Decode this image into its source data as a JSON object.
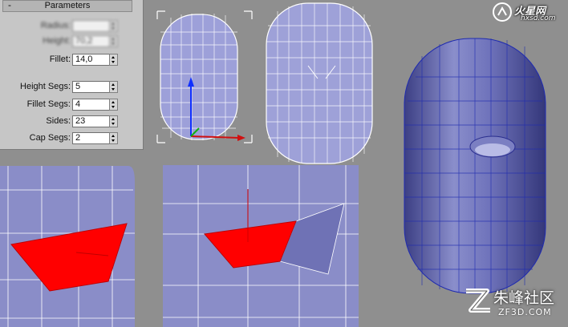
{
  "rollout": {
    "collapse_symbol": "-",
    "title": "Parameters",
    "fields": [
      {
        "label": "Radius:",
        "value": "",
        "obscured": true
      },
      {
        "label": "Height:",
        "value": "70,2",
        "obscured": true
      },
      {
        "label": "Fillet:",
        "value": "14,0",
        "obscured": false
      },
      {
        "label": "Height Segs:",
        "value": "5",
        "obscured": false
      },
      {
        "label": "Fillet Segs:",
        "value": "4",
        "obscured": false
      },
      {
        "label": "Sides:",
        "value": "23",
        "obscured": false
      },
      {
        "label": "Cap Segs:",
        "value": "2",
        "obscured": false
      }
    ]
  },
  "watermarks": {
    "top_brand": "火星网",
    "top_url": "hxsd.com",
    "bottom_brand": "朱峰社区",
    "bottom_url": "ZF3D.COM"
  },
  "colors": {
    "viewport_bg": "#8f8f8f",
    "model_fill": "#8a8ecb",
    "model_dark": "#3c3f84",
    "wire_white": "#ffffff",
    "wire_blue": "#1f2bb0",
    "selection_red": "#ff0000"
  }
}
